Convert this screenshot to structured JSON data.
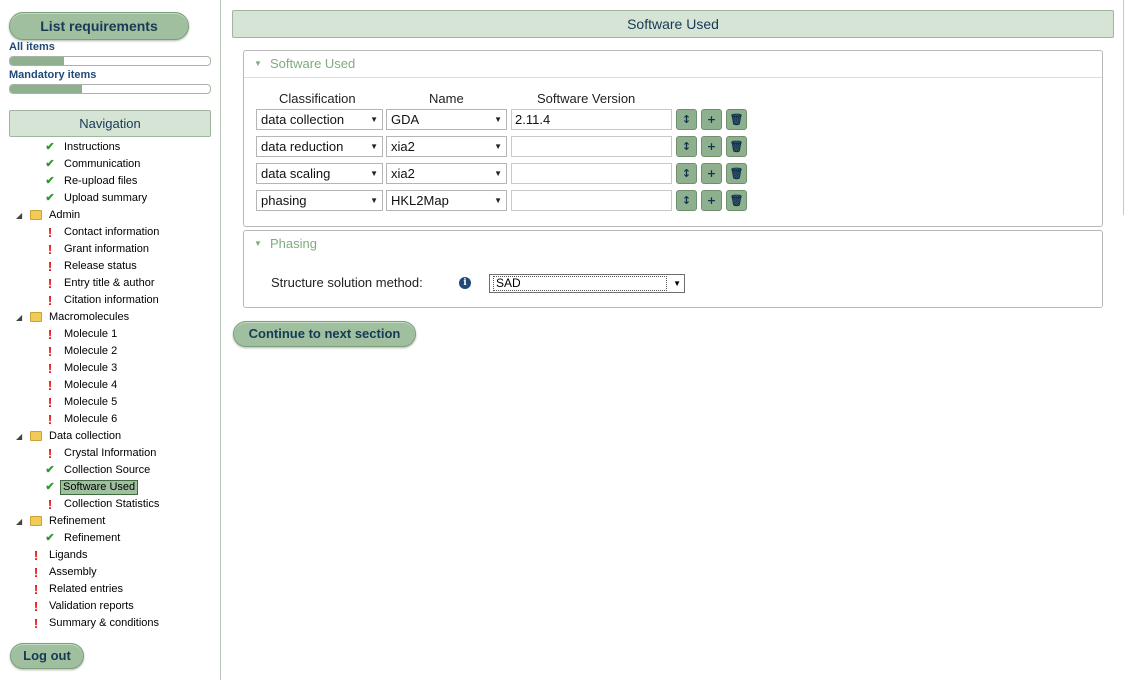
{
  "sidebar": {
    "list_requirements_label": "List requirements",
    "all_items_label": "All items",
    "all_items_progress": 0.27,
    "mandatory_items_label": "Mandatory items",
    "mandatory_items_progress": 0.36,
    "navigation_label": "Navigation",
    "logout_label": "Log out",
    "tree": [
      {
        "label": "Instructions",
        "level": 1,
        "status": "check"
      },
      {
        "label": "Communication",
        "level": 1,
        "status": "check"
      },
      {
        "label": "Re-upload files",
        "level": 1,
        "status": "check"
      },
      {
        "label": "Upload summary",
        "level": 1,
        "status": "check"
      },
      {
        "label": "Admin",
        "level": 0,
        "status": "folder"
      },
      {
        "label": "Contact information",
        "level": 1,
        "status": "error"
      },
      {
        "label": "Grant information",
        "level": 1,
        "status": "error"
      },
      {
        "label": "Release status",
        "level": 1,
        "status": "error"
      },
      {
        "label": "Entry title & author",
        "level": 1,
        "status": "error"
      },
      {
        "label": "Citation information",
        "level": 1,
        "status": "error"
      },
      {
        "label": "Macromolecules",
        "level": 0,
        "status": "folder"
      },
      {
        "label": "Molecule 1",
        "level": 1,
        "status": "error"
      },
      {
        "label": "Molecule 2",
        "level": 1,
        "status": "error"
      },
      {
        "label": "Molecule 3",
        "level": 1,
        "status": "error"
      },
      {
        "label": "Molecule 4",
        "level": 1,
        "status": "error"
      },
      {
        "label": "Molecule 5",
        "level": 1,
        "status": "error"
      },
      {
        "label": "Molecule 6",
        "level": 1,
        "status": "error"
      },
      {
        "label": "Data collection",
        "level": 0,
        "status": "folder"
      },
      {
        "label": "Crystal Information",
        "level": 1,
        "status": "error"
      },
      {
        "label": "Collection Source",
        "level": 1,
        "status": "check"
      },
      {
        "label": "Software Used",
        "level": 1,
        "status": "check",
        "selected": true
      },
      {
        "label": "Collection Statistics",
        "level": 1,
        "status": "error"
      },
      {
        "label": "Refinement",
        "level": 0,
        "status": "folder"
      },
      {
        "label": "Refinement",
        "level": 1,
        "status": "check"
      },
      {
        "label": "Ligands",
        "level": 0,
        "status": "error"
      },
      {
        "label": "Assembly",
        "level": 0,
        "status": "error"
      },
      {
        "label": "Related entries",
        "level": 0,
        "status": "error"
      },
      {
        "label": "Validation reports",
        "level": 0,
        "status": "error"
      },
      {
        "label": "Summary & conditions",
        "level": 0,
        "status": "error"
      }
    ]
  },
  "main": {
    "title": "Software Used",
    "software_panel": {
      "title": "Software Used",
      "col_classification": "Classification",
      "col_name": "Name",
      "col_version": "Software Version",
      "rows": [
        {
          "classification": "data collection",
          "name": "GDA",
          "version": "2.11.4"
        },
        {
          "classification": "data reduction",
          "name": "xia2",
          "version": ""
        },
        {
          "classification": "data scaling",
          "name": "xia2",
          "version": ""
        },
        {
          "classification": "phasing",
          "name": "HKL2Map",
          "version": ""
        }
      ]
    },
    "phasing_panel": {
      "title": "Phasing",
      "method_label": "Structure solution method:",
      "method_value": "SAD"
    },
    "continue_label": "Continue to next section"
  }
}
